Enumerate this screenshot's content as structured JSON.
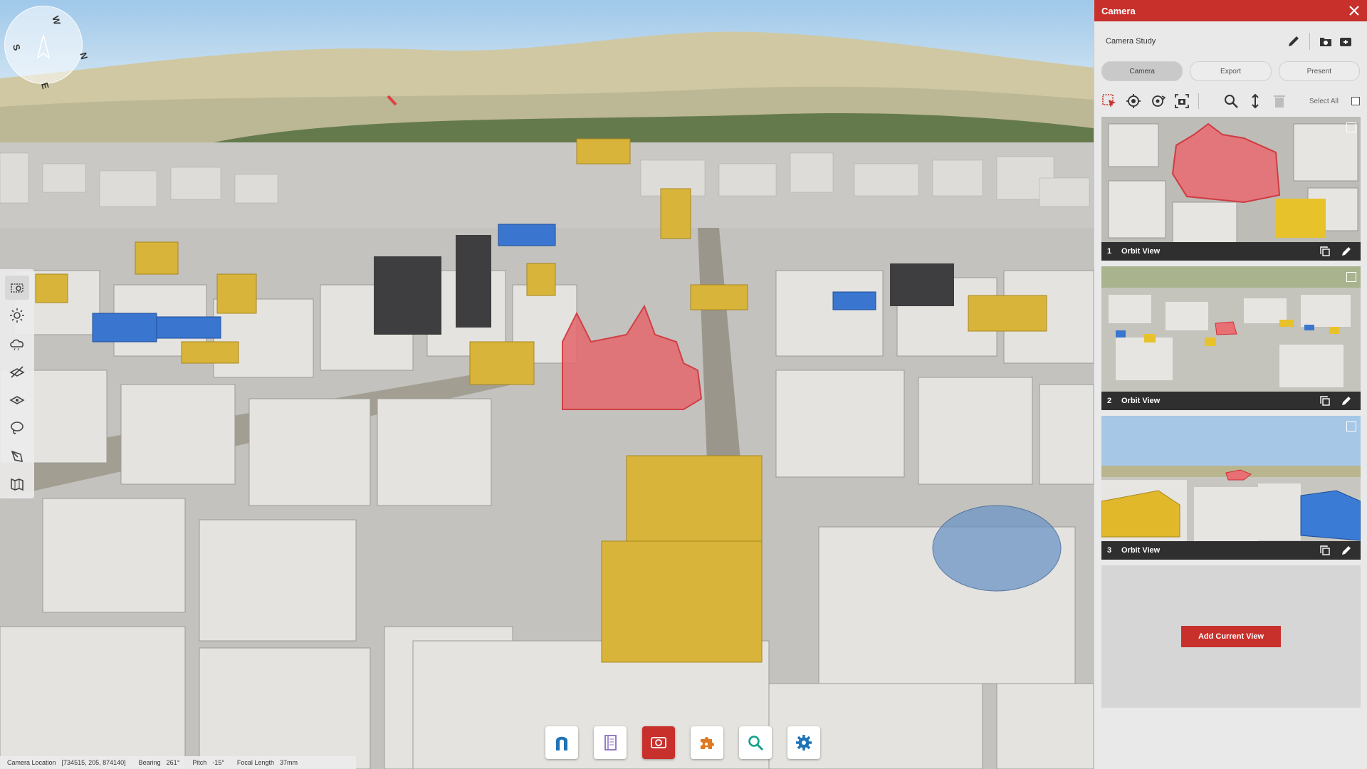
{
  "viewport": {
    "compass": {
      "n": "N",
      "e": "E",
      "s": "S",
      "w": "W"
    },
    "left_toolbar": [
      {
        "icon": "camera-icon",
        "active": true
      },
      {
        "icon": "sun-icon"
      },
      {
        "icon": "cloud-icon"
      },
      {
        "icon": "hide-icon"
      },
      {
        "icon": "layers-icon"
      },
      {
        "icon": "lasso-icon"
      },
      {
        "icon": "pen-icon"
      },
      {
        "icon": "map-icon"
      }
    ],
    "dock": [
      {
        "icon": "magnet-icon",
        "color": "#1f73b7"
      },
      {
        "icon": "notebook-icon",
        "color": "#8a6fbf"
      },
      {
        "icon": "camera-icon",
        "color": "#ffffff",
        "active": true
      },
      {
        "icon": "puzzle-icon",
        "color": "#e07a22"
      },
      {
        "icon": "search-icon",
        "color": "#15a08a"
      },
      {
        "icon": "gear-icon",
        "color": "#1f73b7"
      }
    ],
    "status": {
      "camera_location_label": "Camera Location",
      "camera_location_value": "[734515, 205, 874140]",
      "bearing_label": "Bearing",
      "bearing_value": "261°",
      "pitch_label": "Pitch",
      "pitch_value": "-15°",
      "focal_label": "Focal Length",
      "focal_value": "37mm"
    }
  },
  "panel": {
    "title": "Camera",
    "study_name": "Camera Study",
    "tabs": [
      {
        "label": "Camera",
        "active": true
      },
      {
        "label": "Export"
      },
      {
        "label": "Present"
      }
    ],
    "select_all_label": "Select All",
    "views": [
      {
        "number": "1",
        "name": "Orbit View"
      },
      {
        "number": "2",
        "name": "Orbit View"
      },
      {
        "number": "3",
        "name": "Orbit View"
      }
    ],
    "add_view_label": "Add Current View",
    "accent_color": "#c8302c"
  }
}
